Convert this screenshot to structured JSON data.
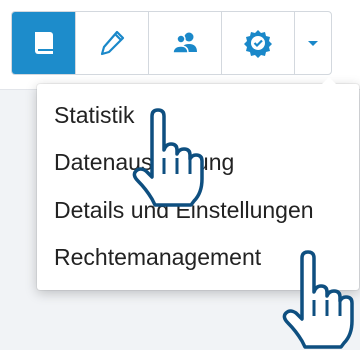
{
  "toolbar": {
    "buttons": [
      {
        "icon": "book-icon",
        "active": true
      },
      {
        "icon": "pencil-icon",
        "active": false
      },
      {
        "icon": "users-icon",
        "active": false
      },
      {
        "icon": "checkmark-badge-icon",
        "active": false
      },
      {
        "icon": "chevron-down-icon",
        "active": false
      }
    ],
    "accent_color": "#1d8ccb",
    "icon_color": "#1a88c9"
  },
  "dropdown": {
    "items": [
      {
        "label": "Statistik"
      },
      {
        "label": "Datenauswertung"
      },
      {
        "label": "Details und Einstellungen"
      },
      {
        "label": "Rechtemanagement"
      }
    ]
  },
  "cursors": [
    "hand-pointer-icon",
    "hand-pointer-icon"
  ]
}
